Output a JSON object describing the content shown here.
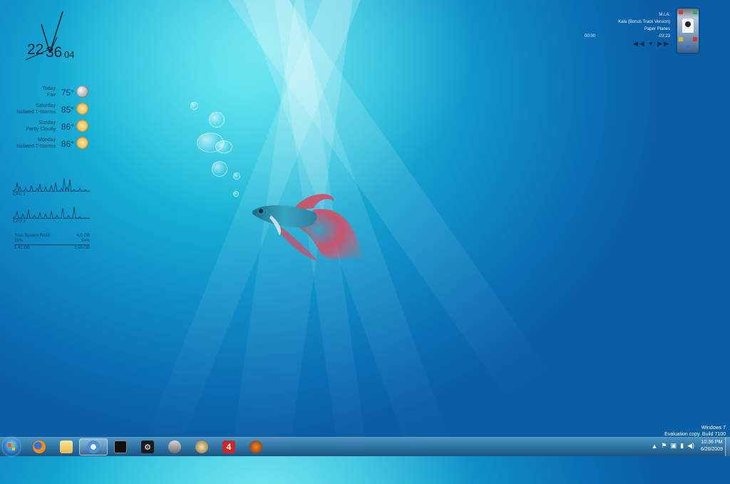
{
  "clock": {
    "hours": "22",
    "minutes": "36",
    "seconds": "04"
  },
  "weather": [
    {
      "day": "Today",
      "condition": "Fair",
      "temp": "75°",
      "icon": "moon-icon"
    },
    {
      "day": "Saturday",
      "condition": "Isolated T-Storms",
      "temp": "85°",
      "icon": "storm-icon"
    },
    {
      "day": "Sunday",
      "condition": "Partly Cloudy",
      "temp": "86°",
      "icon": "partly-cloudy-icon"
    },
    {
      "day": "Monday",
      "condition": "Isolated T-Storms",
      "temp": "86°",
      "icon": "storm-icon"
    }
  ],
  "cpu": {
    "cpu1_label": "CPU 1",
    "cpu2_label": "CPU 2"
  },
  "ram": {
    "total_label": "Total System RAM:",
    "total_value": "4.0 GB",
    "used_pct": "35%",
    "free_pct": "64%",
    "used_value": "1.41 GB",
    "free_value": "2.58 GB"
  },
  "music": {
    "artist": "M.I.A.",
    "album": "Kala (Bonus Track Version)",
    "track": "Paper Planes",
    "elapsed": "00:00",
    "remaining": "-03:23",
    "controls": "◀◀ ♥ ▶▶"
  },
  "watermark": {
    "line1": "Windows 7",
    "line2": "Evaluation copy. Build 7100"
  },
  "taskbar": {
    "items": [
      {
        "name": "firefox"
      },
      {
        "name": "windows-explorer"
      },
      {
        "name": "itunes"
      },
      {
        "name": "app-black-1"
      },
      {
        "name": "steam"
      },
      {
        "name": "app-tool"
      },
      {
        "name": "counter-strike"
      },
      {
        "name": "left-4-dead"
      },
      {
        "name": "half-life"
      }
    ],
    "time": "10:36 PM",
    "date": "6/26/2009"
  },
  "colors": {
    "accent": "#1b8fd0",
    "taskbar": "#2a6690"
  }
}
